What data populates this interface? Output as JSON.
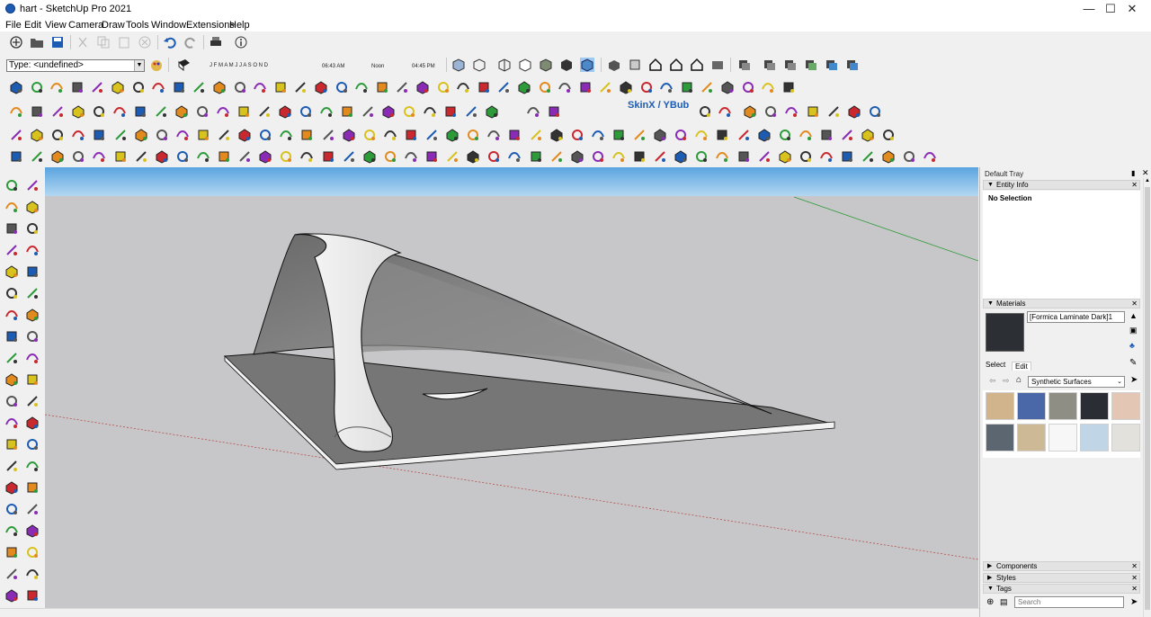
{
  "window": {
    "title": "hart - SketchUp Pro 2021",
    "controls": [
      "minimize-icon",
      "maximize-icon",
      "close-icon"
    ]
  },
  "menu": [
    "File",
    "Edit",
    "View",
    "Camera",
    "Draw",
    "Tools",
    "Window",
    "Extensions",
    "Help"
  ],
  "entity_type": {
    "label": "Type: <undefined>"
  },
  "shadows": {
    "months": "J F M A M J J A S O N D",
    "time_start": "06:43 AM",
    "time_mid": "Noon",
    "time_end": "04:45 PM"
  },
  "extensions": {
    "skinx_label": "SkinX / YBub"
  },
  "tray": {
    "title": "Default Tray",
    "entity_info": {
      "header": "Entity Info",
      "selection": "No Selection"
    },
    "materials": {
      "header": "Materials",
      "current_name": "[Formica Laminate Dark]1",
      "tab_select": "Select",
      "tab_edit": "Edit",
      "library": "Synthetic Surfaces",
      "swatch_colors": [
        "#d2b48c",
        "#4a68a8",
        "#8e8e84",
        "#2a2d33",
        "#e3c6b3",
        "#5c6670",
        "#cdb995",
        "#f7f7f7",
        "#c0d6e6",
        "#e3e1dc"
      ]
    },
    "components": {
      "header": "Components"
    },
    "styles": {
      "header": "Styles"
    },
    "tags": {
      "header": "Tags",
      "search_placeholder": "Search"
    }
  },
  "colors": {
    "viewport_bg": "#c7c7c9",
    "sky_top": "#5aa4e0",
    "current_material": "#2c3035",
    "accent_blue": "#1d5cb3"
  }
}
